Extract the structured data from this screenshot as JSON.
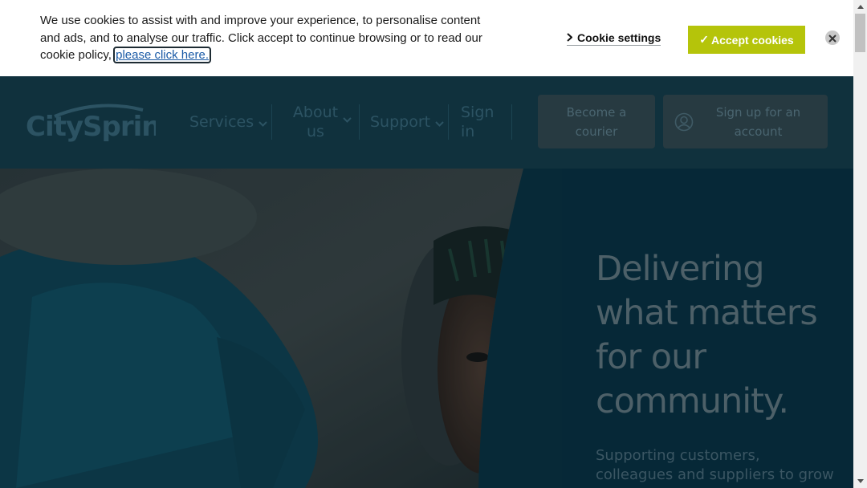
{
  "cookie_banner": {
    "text": "We use cookies to assist with and improve your experience, to personalise content and ads, and to analyse our traffic. Click accept to continue browsing or to read our cookie policy,",
    "link_text": "please click here.",
    "settings_label": "Cookie settings",
    "accept_label": "Accept cookies",
    "accept_color": "#b5c40a"
  },
  "header": {
    "logo_text": "CitySprint",
    "nav": [
      {
        "label": "Services",
        "icon": "chevron-down-icon"
      },
      {
        "label": "About us",
        "icon": "chevron-down-icon"
      },
      {
        "label": "Support",
        "icon": "chevron-down-icon"
      },
      {
        "label": "Sign in"
      }
    ],
    "become_courier": "Become a courier",
    "sign_up": "Sign up for an account",
    "background": "#10313d"
  },
  "hero": {
    "title": "Delivering what matters for our community.",
    "subtitle": "Supporting customers, colleagues and suppliers to grow"
  }
}
